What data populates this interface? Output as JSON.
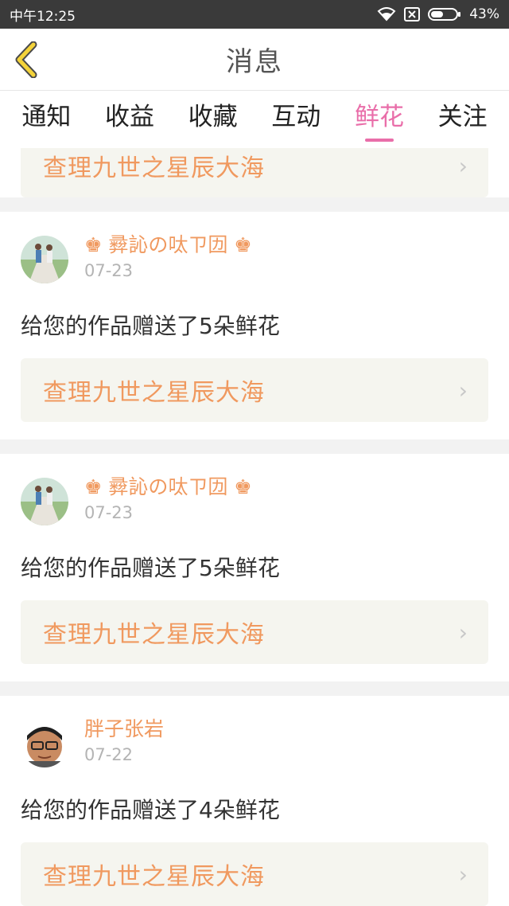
{
  "status_bar": {
    "time": "中午12:25",
    "battery": "43%"
  },
  "header": {
    "title": "消息",
    "back_icon": "chevron-left-icon",
    "accent_color": "#f4d33a"
  },
  "tabs": [
    {
      "label": "通知",
      "active": false
    },
    {
      "label": "收益",
      "active": false
    },
    {
      "label": "收藏",
      "active": false
    },
    {
      "label": "互动",
      "active": false
    },
    {
      "label": "鲜花",
      "active": true
    },
    {
      "label": "关注",
      "active": false
    }
  ],
  "colors": {
    "tab_active": "#e96ea9",
    "accent_orange": "#f0995f",
    "link_bg": "#f5f5ef"
  },
  "partial_card": {
    "work_title": "查理九世之星辰大海"
  },
  "messages": [
    {
      "user": "♚ 彛訫の呔ㄗ㘞 ♚",
      "date": "07-23",
      "text": "给您的作品赠送了5朵鲜花",
      "work_title": "查理九世之星辰大海"
    },
    {
      "user": "♚ 彛訫の呔ㄗ㘞 ♚",
      "date": "07-23",
      "text": "给您的作品赠送了5朵鲜花",
      "work_title": "查理九世之星辰大海"
    },
    {
      "user": "胖子张岩",
      "date": "07-22",
      "text": "给您的作品赠送了4朵鲜花",
      "work_title": "查理九世之星辰大海"
    }
  ]
}
